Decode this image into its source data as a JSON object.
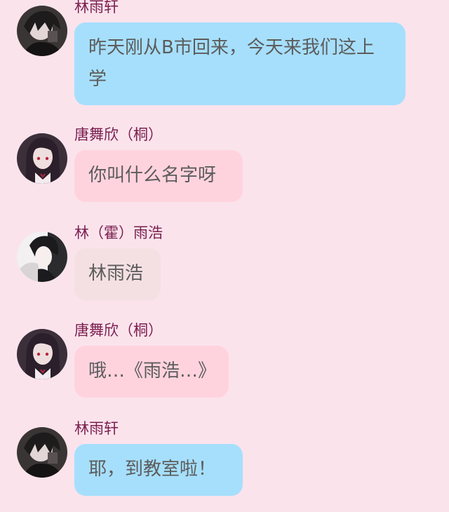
{
  "chat": {
    "messages": [
      {
        "sender": "林雨轩",
        "text": "昨天刚从B市回来，今天来我们这上学",
        "bubble_color": "#a6dffc",
        "avatar": "boy-dark-hair-avatar"
      },
      {
        "sender": "唐舞欣（桐）",
        "text": "你叫什么名字呀",
        "bubble_color": "#ffd3de",
        "avatar": "girl-long-hair-avatar"
      },
      {
        "sender": "林（霍）雨浩",
        "text": "林雨浩",
        "bubble_color": "#f4e0e2",
        "avatar": "boy-light-avatar"
      },
      {
        "sender": "唐舞欣（桐）",
        "text": "哦…《雨浩…》",
        "bubble_color": "#ffd3de",
        "avatar": "girl-long-hair-avatar"
      },
      {
        "sender": "林雨轩",
        "text": "耶，到教室啦！",
        "bubble_color": "#a6dffc",
        "avatar": "boy-dark-hair-avatar"
      }
    ]
  }
}
